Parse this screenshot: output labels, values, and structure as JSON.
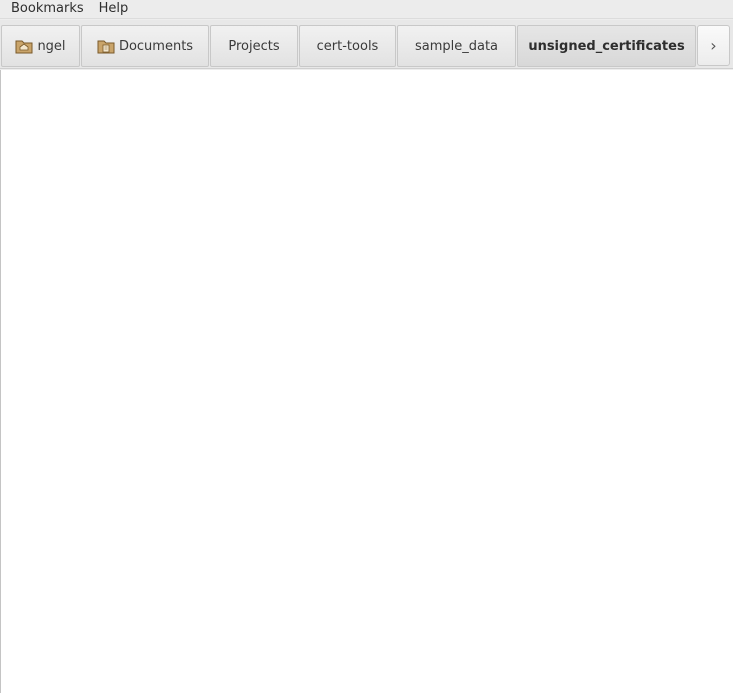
{
  "menubar": {
    "items": [
      {
        "label": "Bookmarks"
      },
      {
        "label": "Help"
      }
    ]
  },
  "pathbar": {
    "crumbs": [
      {
        "label": "ngel",
        "icon": "home-folder-icon"
      },
      {
        "label": "Documents",
        "icon": "documents-folder-icon"
      },
      {
        "label": "Projects"
      },
      {
        "label": "cert-tools"
      },
      {
        "label": "sample_data"
      },
      {
        "label": "unsigned_certificates",
        "active": true
      }
    ],
    "next_glyph": "›"
  },
  "colors": {
    "folder_fill": "#c9a46a",
    "folder_stroke": "#7a5a2a",
    "content_bg": "#ffffff"
  }
}
